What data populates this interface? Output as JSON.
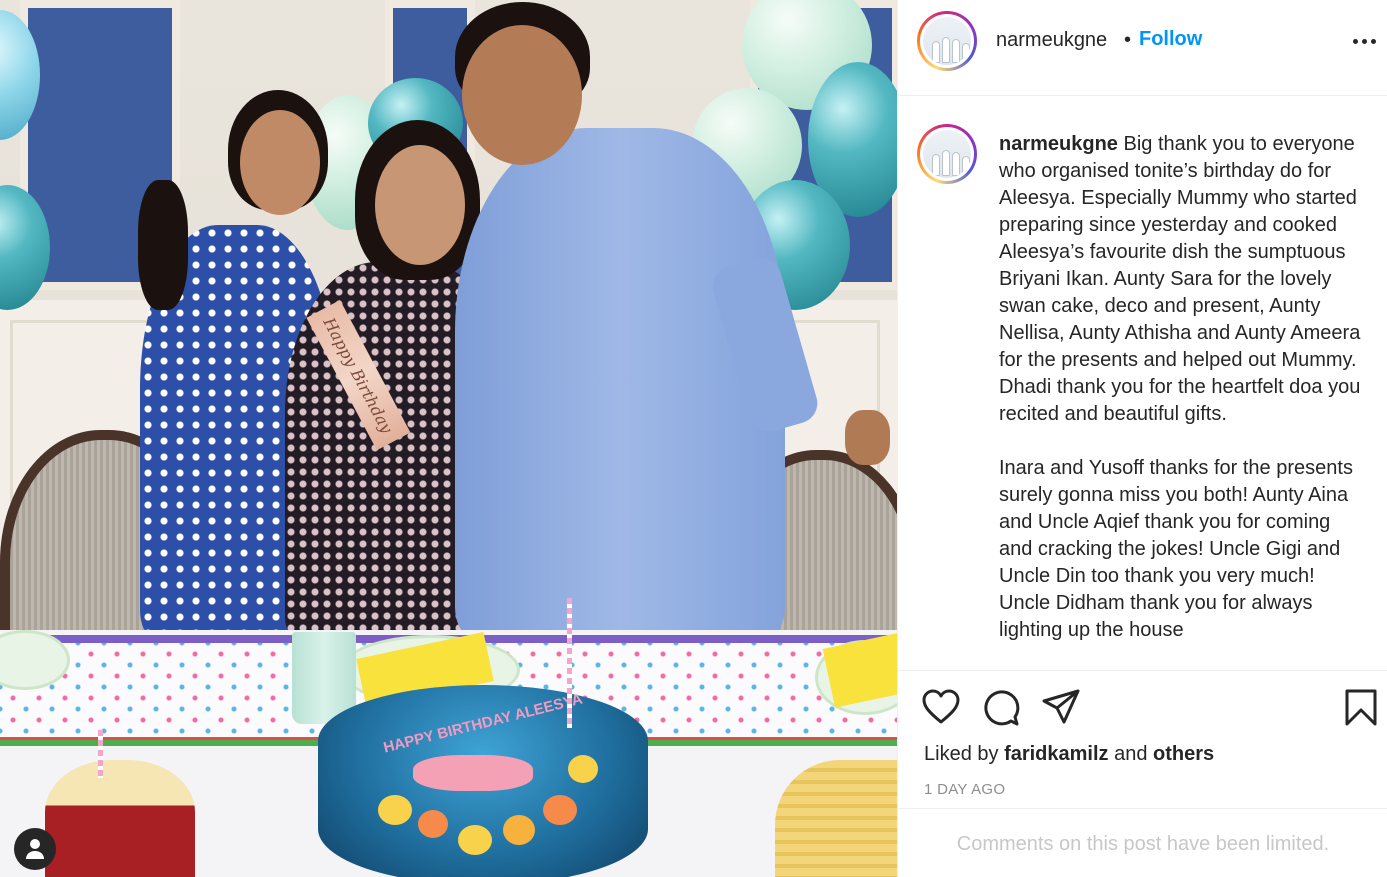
{
  "post": {
    "username": "narmeukgne",
    "separator": "•",
    "follow_label": "Follow",
    "caption_user": "narmeukgne",
    "caption_text": " Big thank you to everyone who organised tonite’s birthday do for Aleesya. Especially Mummy who started preparing since yesterday and cooked Aleesya’s favourite dish the sumptuous Briyani Ikan. Aunty Sara for the lovely swan cake, deco and present, Aunty Nellisa, Aunty Athisha and Aunty Ameera for the presents and helped out Mummy. Dhadi thank you for the heartfelt doa you recited and beautiful gifts.\n\nInara and Yusoff thanks for the presents surely gonna miss you both! Aunty Aina and Uncle Aqief thank you for coming and cracking the jokes! Uncle Gigi and Uncle Din too thank you very much! Uncle Didham thank you for always lighting up the house",
    "liked_by_prefix": "Liked by ",
    "liked_by_user": "faridkamilz",
    "liked_by_and": " and ",
    "liked_by_others": "others",
    "time_ago": "1 DAY AGO",
    "comments_notice": "Comments on this post have been limited."
  },
  "photo": {
    "sash_text": "Happy Birthday",
    "cake_text": "HAPPY BIRTHDAY ALEESYA"
  },
  "icons": {
    "like": "heart-icon",
    "comment": "comment-icon",
    "share": "share-icon",
    "save": "bookmark-icon",
    "more": "more-icon",
    "user": "user-icon"
  },
  "colors": {
    "follow": "#0095f6",
    "text": "#262626",
    "muted": "#8e8e8e",
    "disabled": "#c7c7c7"
  }
}
